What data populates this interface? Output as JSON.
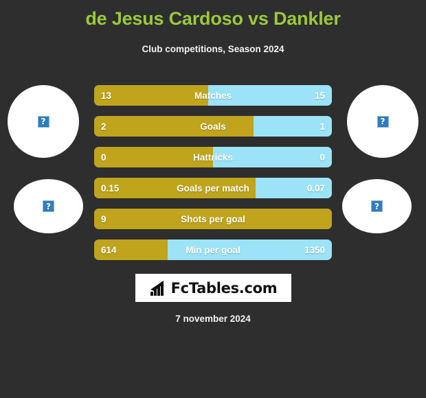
{
  "header": {
    "title": "de Jesus Cardoso vs Dankler",
    "subtitle": "Club competitions, Season 2024",
    "title_color": "#9bc938"
  },
  "avatars": {
    "left_player": {
      "name": "left-player-photo",
      "placeholder_glyph": "?"
    },
    "right_player": {
      "name": "right-player-photo",
      "placeholder_glyph": "?"
    },
    "left_club": {
      "name": "left-club-logo",
      "placeholder_glyph": "?"
    },
    "right_club": {
      "name": "right-club-logo",
      "placeholder_glyph": "?"
    }
  },
  "footer": {
    "logo_text": "FcTables.com",
    "logo_icon": "bar-chart-icon",
    "date": "7 november 2024"
  },
  "colors": {
    "background": "#2e2e2e",
    "home": "#bfa41c",
    "away": "#9ce3f7",
    "text": "#ffffff"
  },
  "chart_data": {
    "type": "bar",
    "title": "de Jesus Cardoso vs Dankler",
    "subtitle": "Club competitions, Season 2024",
    "orientation": "horizontal-diverging",
    "series": [
      {
        "name": "de Jesus Cardoso",
        "color": "#bfa41c",
        "side": "home"
      },
      {
        "name": "Dankler",
        "color": "#9ce3f7",
        "side": "away"
      }
    ],
    "categories": [
      "Matches",
      "Goals",
      "Hattricks",
      "Goals per match",
      "Shots per goal",
      "Min per goal"
    ],
    "rows": [
      {
        "label": "Matches",
        "home": "13",
        "away": "15",
        "home_pct": 48
      },
      {
        "label": "Goals",
        "home": "2",
        "away": "1",
        "home_pct": 67
      },
      {
        "label": "Hattricks",
        "home": "0",
        "away": "0",
        "home_pct": 50
      },
      {
        "label": "Goals per match",
        "home": "0.15",
        "away": "0.07",
        "home_pct": 68
      },
      {
        "label": "Shots per goal",
        "home": "9",
        "away": "",
        "home_pct": 100
      },
      {
        "label": "Min per goal",
        "home": "614",
        "away": "1350",
        "home_pct": 31
      }
    ]
  }
}
